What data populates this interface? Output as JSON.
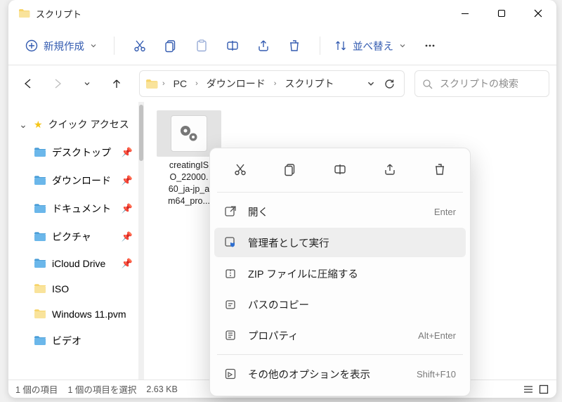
{
  "window": {
    "title": "スクリプト"
  },
  "toolbar": {
    "new_label": "新規作成",
    "sort_label": "並べ替え"
  },
  "nav": {
    "crumbs": [
      "PC",
      "ダウンロード",
      "スクリプト"
    ]
  },
  "search": {
    "placeholder": "スクリプトの検索"
  },
  "sidebar": {
    "quick_access": "クイック アクセス",
    "items": [
      {
        "label": "デスクトップ",
        "pinned": true
      },
      {
        "label": "ダウンロード",
        "pinned": true
      },
      {
        "label": "ドキュメント",
        "pinned": true
      },
      {
        "label": "ピクチャ",
        "pinned": true
      },
      {
        "label": "iCloud Drive",
        "pinned": true
      },
      {
        "label": "ISO",
        "pinned": false
      },
      {
        "label": "Windows 11.pvm",
        "pinned": false
      },
      {
        "label": "ビデオ",
        "pinned": false
      }
    ]
  },
  "file": {
    "name_line1": "creatingIS",
    "name_line2": "O_22000.",
    "name_line3": "60_ja-jp_a",
    "name_line4": "m64_pro..."
  },
  "context_menu": {
    "open": "開く",
    "open_accel": "Enter",
    "run_admin": "管理者として実行",
    "zip": "ZIP ファイルに圧縮する",
    "copy_path": "パスのコピー",
    "properties": "プロパティ",
    "properties_accel": "Alt+Enter",
    "more": "その他のオプションを表示",
    "more_accel": "Shift+F10"
  },
  "status": {
    "count": "1 個の項目",
    "selected": "1 個の項目を選択",
    "size": "2.63 KB"
  }
}
